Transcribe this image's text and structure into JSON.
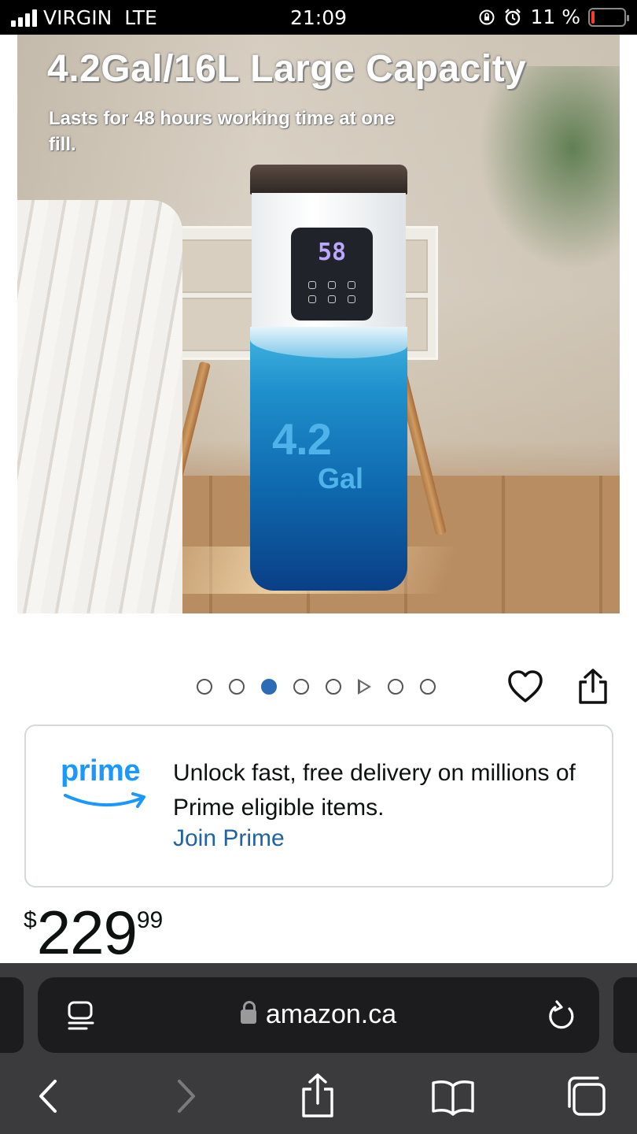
{
  "status_bar": {
    "carrier": "VIRGIN",
    "network": "LTE",
    "time": "21:09",
    "battery_percent": "11 %",
    "battery_level": 0.11,
    "battery_color": "#ff3b30"
  },
  "product_image": {
    "headline": "4.2Gal/16L Large Capacity",
    "subline": "Lasts for 48 hours working time at one fill.",
    "display_reading": "58",
    "tank_value": "4.2",
    "tank_unit": "Gal"
  },
  "gallery": {
    "dots": [
      "dot",
      "dot",
      "dot-active",
      "dot",
      "dot",
      "video",
      "dot",
      "dot"
    ],
    "active_index": 2,
    "active_color": "#2c6bb5",
    "wishlist_icon": "heart-icon",
    "share_icon": "share-icon"
  },
  "prime": {
    "logo_text": "prime",
    "logo_color": "#1a98ff",
    "message": "Unlock fast, free delivery on millions of Prime eligible items.",
    "link_label": "Join Prime",
    "link_color": "#2162a1"
  },
  "price": {
    "symbol": "$",
    "whole": "229",
    "fraction": "99"
  },
  "browser": {
    "url": "amazon.ca",
    "reader_icon": "reader-icon",
    "reload_icon": "reload-icon",
    "toolbar": [
      "back-icon",
      "forward-icon",
      "share-icon",
      "bookmarks-icon",
      "tabs-icon"
    ]
  }
}
